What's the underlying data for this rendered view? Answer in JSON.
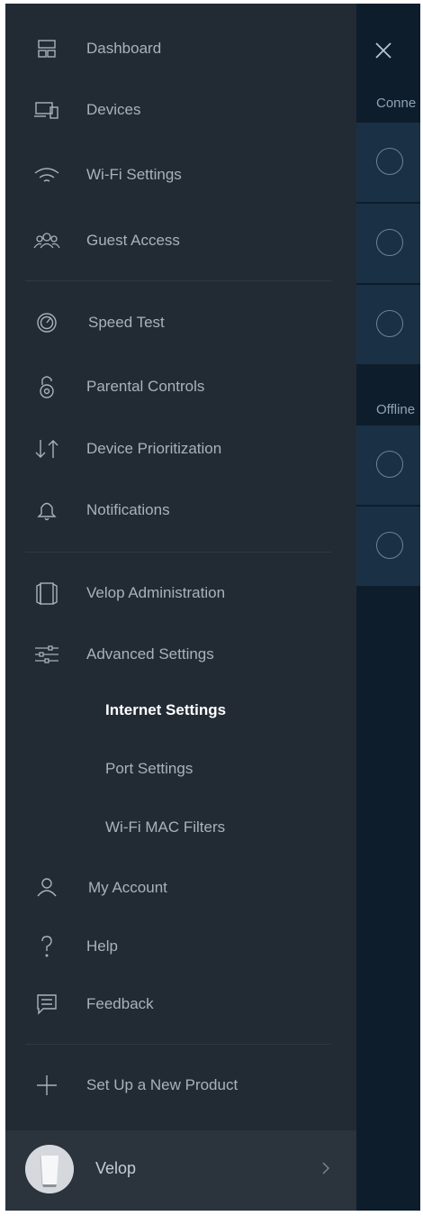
{
  "background": {
    "sections": [
      "Conne",
      "Offline"
    ]
  },
  "menu": {
    "items": [
      {
        "label": "Dashboard",
        "icon": "dashboard-icon"
      },
      {
        "label": "Devices",
        "icon": "devices-icon"
      },
      {
        "label": "Wi-Fi Settings",
        "icon": "wifi-icon"
      },
      {
        "label": "Guest Access",
        "icon": "guest-icon"
      },
      {
        "label": "Speed Test",
        "icon": "speedometer-icon"
      },
      {
        "label": "Parental Controls",
        "icon": "lock-icon"
      },
      {
        "label": "Device Prioritization",
        "icon": "priority-arrows-icon"
      },
      {
        "label": "Notifications",
        "icon": "bell-icon"
      },
      {
        "label": "Velop Administration",
        "icon": "velop-node-icon"
      },
      {
        "label": "Advanced Settings",
        "icon": "sliders-icon"
      },
      {
        "label": "My Account",
        "icon": "user-icon"
      },
      {
        "label": "Help",
        "icon": "question-icon"
      },
      {
        "label": "Feedback",
        "icon": "feedback-icon"
      },
      {
        "label": "Set Up a New Product",
        "icon": "plus-icon"
      }
    ],
    "submenu": [
      {
        "label": "Internet Settings",
        "active": true
      },
      {
        "label": "Port Settings",
        "active": false
      },
      {
        "label": "Wi-Fi MAC Filters",
        "active": false
      }
    ]
  },
  "footer": {
    "label": "Velop"
  },
  "colors": {
    "drawer_bg": "#222a34",
    "screen_bg": "#0e1d2c",
    "card_bg": "#1a3044",
    "text": "#a9b2bc",
    "active_text": "#ffffff"
  }
}
